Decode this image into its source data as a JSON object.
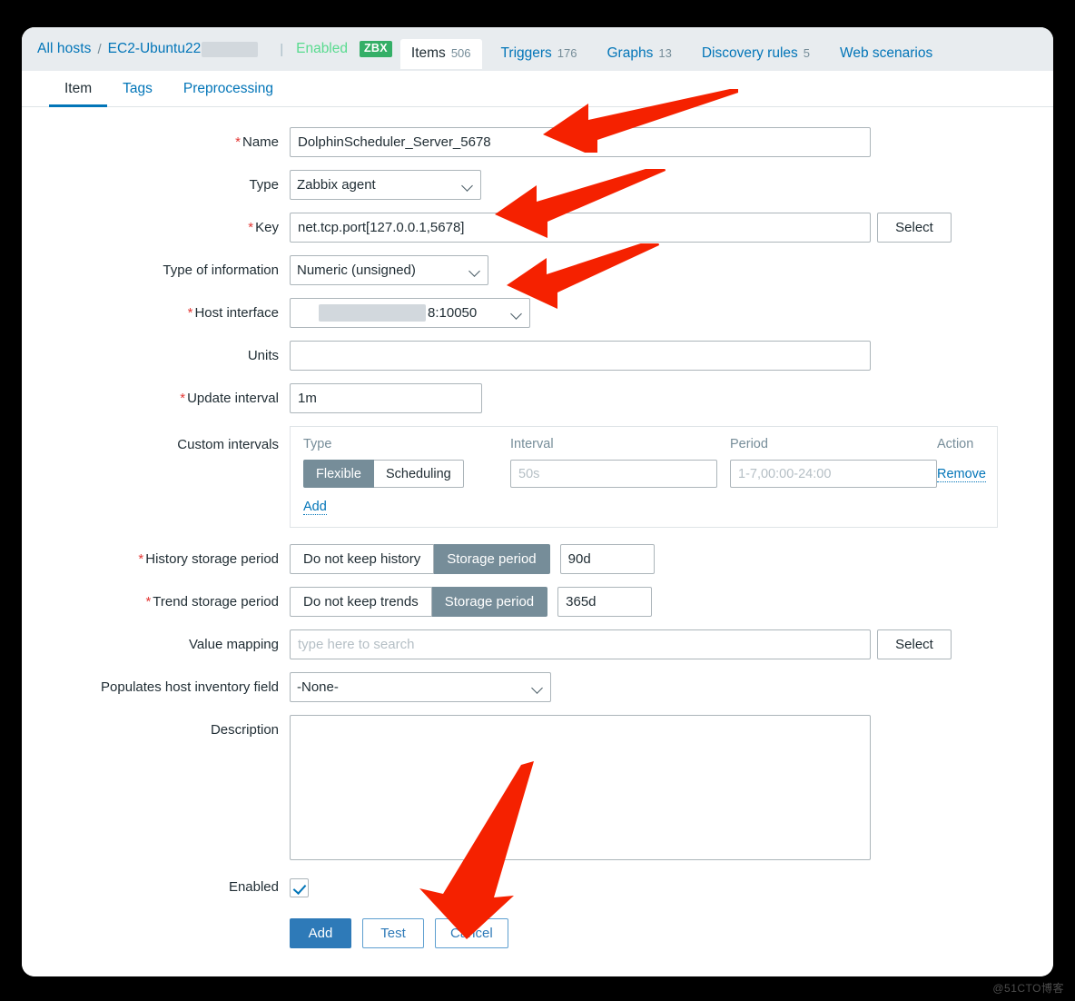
{
  "window": {
    "breadcrumb": {
      "all_hosts": "All hosts",
      "separator": "/",
      "host_name": "EC2-Ubuntu22",
      "divider": "|",
      "status": "Enabled",
      "agent_badge": "ZBX"
    },
    "nav_tabs": [
      {
        "label": "Items",
        "count": "506",
        "active": true
      },
      {
        "label": "Triggers",
        "count": "176",
        "active": false
      },
      {
        "label": "Graphs",
        "count": "13",
        "active": false
      },
      {
        "label": "Discovery rules",
        "count": "5",
        "active": false
      },
      {
        "label": "Web scenarios",
        "count": "",
        "active": false
      }
    ],
    "form_tabs": [
      {
        "label": "Item",
        "active": true
      },
      {
        "label": "Tags",
        "active": false
      },
      {
        "label": "Preprocessing",
        "active": false
      }
    ]
  },
  "form": {
    "name": {
      "label": "Name",
      "required": true,
      "value": "DolphinScheduler_Server_5678"
    },
    "type": {
      "label": "Type",
      "required": false,
      "value": "Zabbix agent"
    },
    "key": {
      "label": "Key",
      "required": true,
      "value": "net.tcp.port[127.0.0.1,5678]",
      "select_label": "Select"
    },
    "type_of_information": {
      "label": "Type of information",
      "required": false,
      "value": "Numeric (unsigned)"
    },
    "host_interface": {
      "label": "Host interface",
      "required": true,
      "value": "8:10050"
    },
    "units": {
      "label": "Units",
      "required": false,
      "value": ""
    },
    "update_interval": {
      "label": "Update interval",
      "required": true,
      "value": "1m"
    },
    "custom_intervals": {
      "label": "Custom intervals",
      "columns": [
        "Type",
        "Interval",
        "Period",
        "Action"
      ],
      "rows": [
        {
          "type_options": [
            "Flexible",
            "Scheduling"
          ],
          "type_selected": "Flexible",
          "interval_placeholder": "50s",
          "interval_value": "",
          "period_placeholder": "1-7,00:00-24:00",
          "period_value": "",
          "action_label": "Remove"
        }
      ],
      "add_label": "Add"
    },
    "history_storage": {
      "label": "History storage period",
      "required": true,
      "options": [
        "Do not keep history",
        "Storage period"
      ],
      "selected": "Storage period",
      "value": "90d"
    },
    "trend_storage": {
      "label": "Trend storage period",
      "required": true,
      "options": [
        "Do not keep trends",
        "Storage period"
      ],
      "selected": "Storage period",
      "value": "365d"
    },
    "value_mapping": {
      "label": "Value mapping",
      "required": false,
      "value": "",
      "placeholder": "type here to search",
      "select_label": "Select"
    },
    "inventory_field": {
      "label": "Populates host inventory field",
      "required": false,
      "value": "-None-"
    },
    "description": {
      "label": "Description",
      "required": false,
      "value": ""
    },
    "enabled": {
      "label": "Enabled",
      "checked": true
    }
  },
  "footer": {
    "add_label": "Add",
    "test_label": "Test",
    "cancel_label": "Cancel"
  },
  "watermark": "@51CTO博客",
  "colors": {
    "accent_blue": "#0275b8",
    "primary_button": "#2e7ab8",
    "status_green": "#59db8f",
    "badge_green": "#34af67",
    "toggle_selected": "#768d99",
    "required_red": "#e33734",
    "arrow_red": "#f52100",
    "nav_bg": "#e8ecef"
  }
}
